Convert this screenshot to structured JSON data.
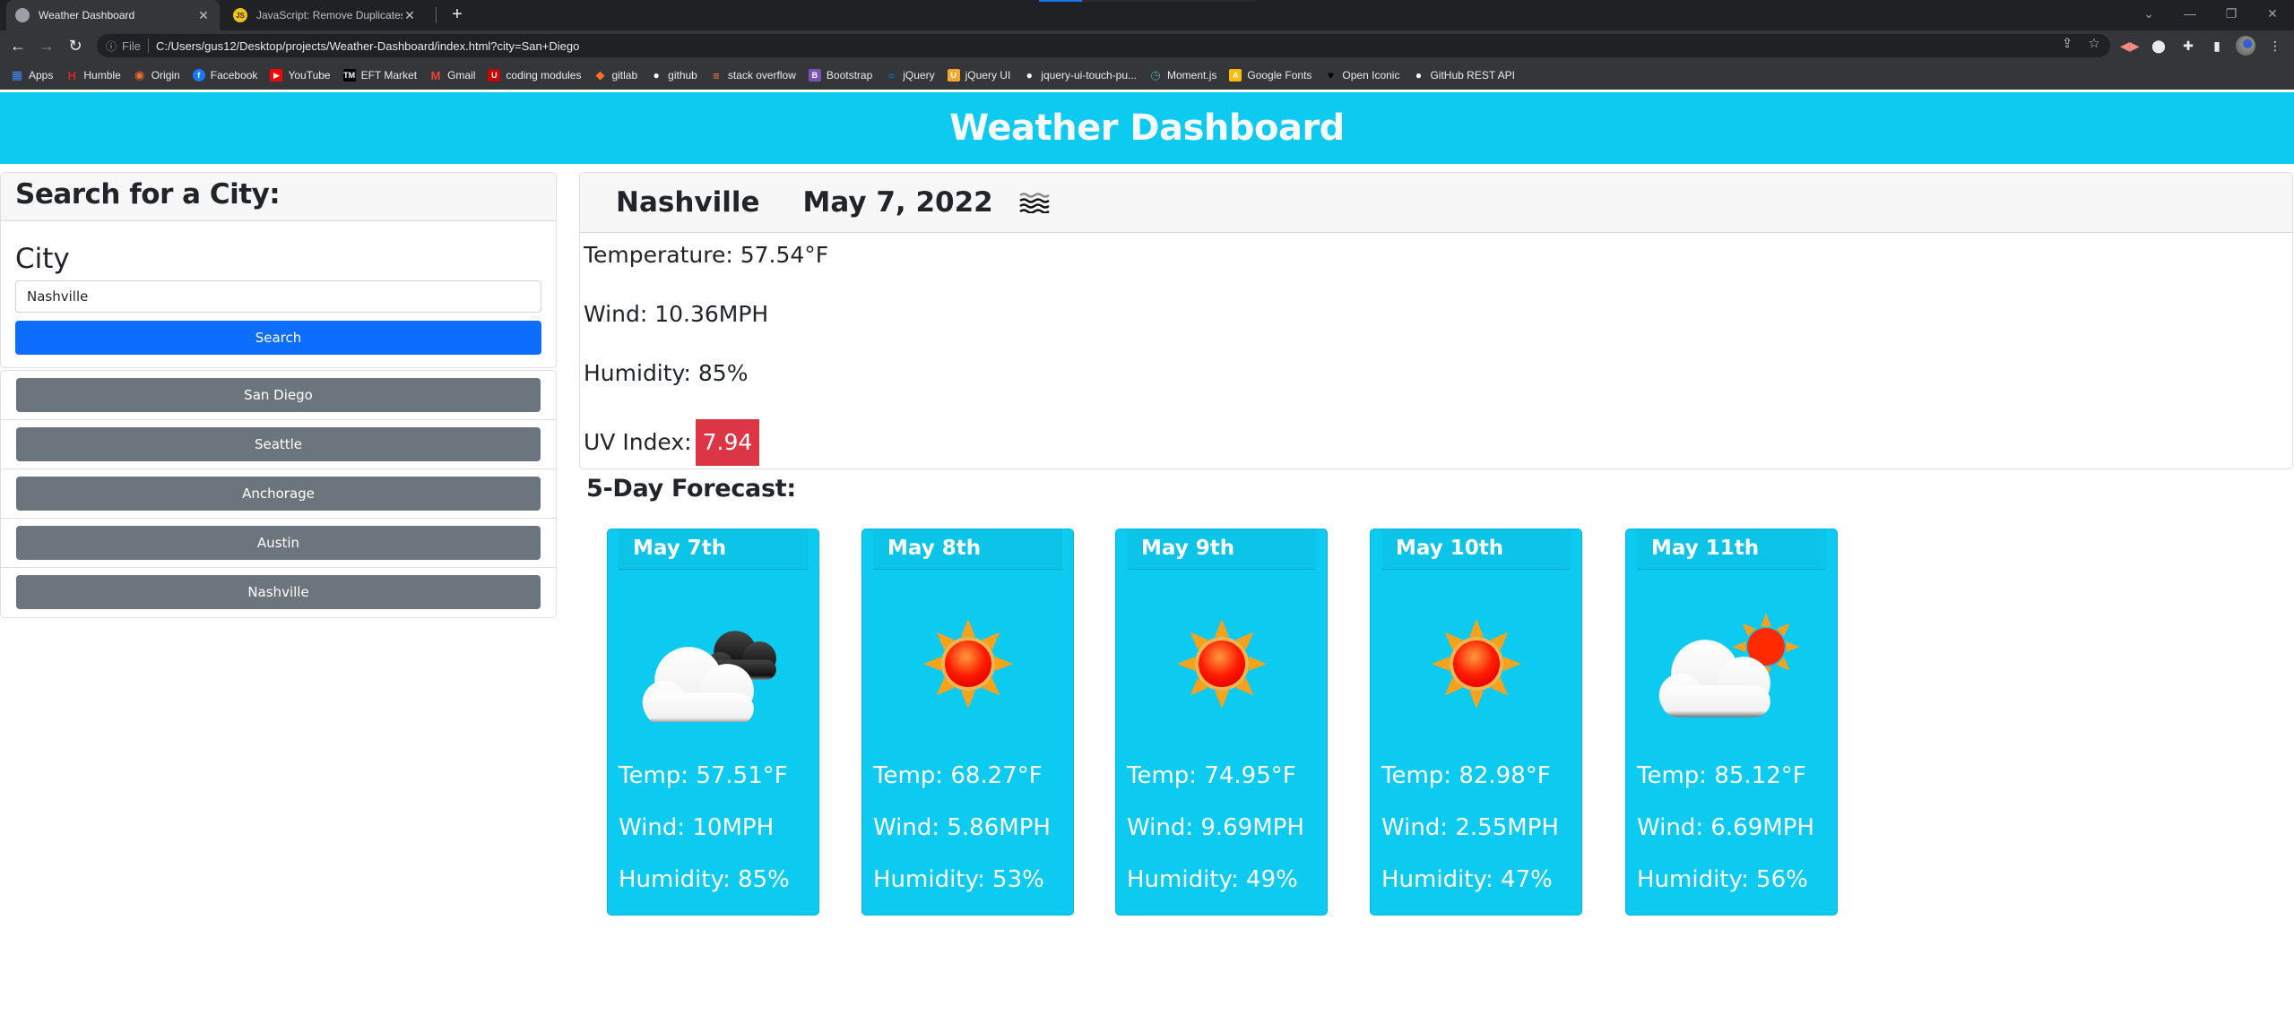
{
  "browser": {
    "tabs": [
      {
        "title": "Weather Dashboard",
        "icon": "globe-icon",
        "active": true
      },
      {
        "title": "JavaScript: Remove Duplicates fro",
        "icon": "js-icon",
        "active": false
      }
    ],
    "new_tab_label": "+",
    "url_scheme": "File",
    "url": "C:/Users/gus12/Desktop/projects/Weather-Dashboard/index.html?city=San+Diego",
    "bookmarks": [
      {
        "label": "Apps",
        "icon": "apps-grid-icon",
        "color": "#4285f4"
      },
      {
        "label": "Humble",
        "icon": "humble-icon",
        "color": "#cc2929"
      },
      {
        "label": "Origin",
        "icon": "origin-icon",
        "color": "#f56c2d"
      },
      {
        "label": "Facebook",
        "icon": "facebook-icon",
        "color": "#1877f2"
      },
      {
        "label": "YouTube",
        "icon": "youtube-icon",
        "color": "#ff0000"
      },
      {
        "label": "EFT Market",
        "icon": "tm-icon",
        "color": "#000000"
      },
      {
        "label": "Gmail",
        "icon": "gmail-icon",
        "color": "#ea4335"
      },
      {
        "label": "coding modules",
        "icon": "utah-u-icon",
        "color": "#cc0000"
      },
      {
        "label": "gitlab",
        "icon": "gitlab-icon",
        "color": "#fc6d26"
      },
      {
        "label": "github",
        "icon": "github-icon",
        "color": "#ffffff"
      },
      {
        "label": "stack overflow",
        "icon": "stackoverflow-icon",
        "color": "#f48024"
      },
      {
        "label": "Bootstrap",
        "icon": "bootstrap-icon",
        "color": "#7952b3"
      },
      {
        "label": "jQuery",
        "icon": "jquery-icon",
        "color": "#0769ad"
      },
      {
        "label": "jQuery UI",
        "icon": "jqueryui-icon",
        "color": "#f6a828"
      },
      {
        "label": "jquery-ui-touch-pu...",
        "icon": "github-icon",
        "color": "#ffffff"
      },
      {
        "label": "Moment.js",
        "icon": "moment-icon",
        "color": "#4fa8a0"
      },
      {
        "label": "Google Fonts",
        "icon": "google-fonts-icon",
        "color": "#fbbc04"
      },
      {
        "label": "Open Iconic",
        "icon": "heart-icon",
        "color": "#000000"
      },
      {
        "label": "GitHub REST API",
        "icon": "github-icon",
        "color": "#ffffff"
      }
    ],
    "load_progress": 0.2
  },
  "header": {
    "title": "Weather Dashboard"
  },
  "search": {
    "heading": "Search for a City:",
    "city_label": "City",
    "input_value": "Nashville",
    "button_label": "Search"
  },
  "history": [
    {
      "label": "San Diego"
    },
    {
      "label": "Seattle"
    },
    {
      "label": "Anchorage"
    },
    {
      "label": "Austin"
    },
    {
      "label": "Nashville"
    }
  ],
  "current": {
    "city": "Nashville",
    "date": "May 7, 2022",
    "icon": "mist-icon",
    "temperature": "Temperature: 57.54°F",
    "wind": "Wind: 10.36MPH",
    "humidity": "Humidity: 85%",
    "uv_label": "UV Index:",
    "uv_value": "7.94",
    "uv_color": "#dc3545"
  },
  "forecast": {
    "title": "5-Day Forecast:",
    "days": [
      {
        "date": "May 7th",
        "icon": "broken-clouds-icon",
        "temp": "Temp: 57.51°F",
        "wind": "Wind: 10MPH",
        "humidity": "Humidity: 85%"
      },
      {
        "date": "May 8th",
        "icon": "clear-sun-icon",
        "temp": "Temp: 68.27°F",
        "wind": "Wind: 5.86MPH",
        "humidity": "Humidity: 53%"
      },
      {
        "date": "May 9th",
        "icon": "clear-sun-icon",
        "temp": "Temp: 74.95°F",
        "wind": "Wind: 9.69MPH",
        "humidity": "Humidity: 49%"
      },
      {
        "date": "May 10th",
        "icon": "clear-sun-icon",
        "temp": "Temp: 82.98°F",
        "wind": "Wind: 2.55MPH",
        "humidity": "Humidity: 47%"
      },
      {
        "date": "May 11th",
        "icon": "few-clouds-icon",
        "temp": "Temp: 85.12°F",
        "wind": "Wind: 6.69MPH",
        "humidity": "Humidity: 56%"
      }
    ]
  },
  "colors": {
    "header_bg": "#0dcaf0",
    "primary": "#0d6efd",
    "secondary": "#6c757d",
    "danger": "#dc3545"
  }
}
